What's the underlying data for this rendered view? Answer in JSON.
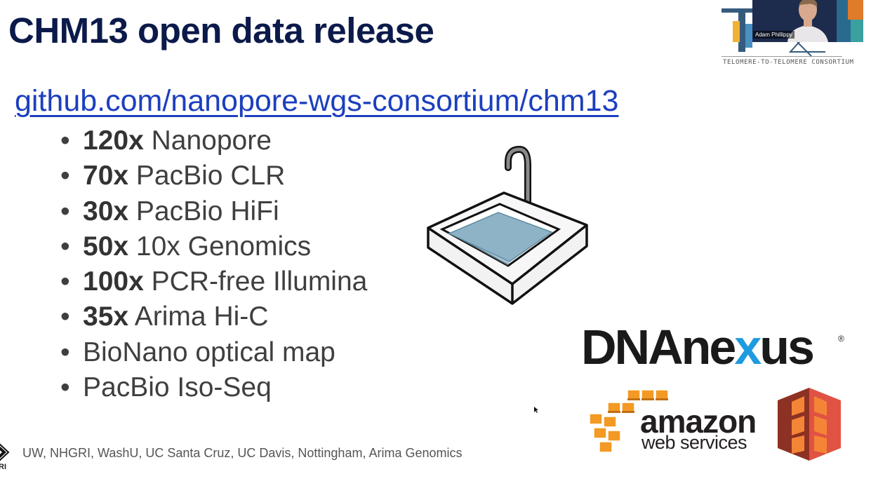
{
  "slide": {
    "title": "CHM13 open data release",
    "link": "github.com/nanopore-wgs-consortium/chm13",
    "bullets": [
      {
        "coverage": "120x",
        "text": " Nanopore"
      },
      {
        "coverage": "70x",
        "text": " PacBio CLR"
      },
      {
        "coverage": "30x",
        "text": " PacBio HiFi"
      },
      {
        "coverage": "50x",
        "text": " 10x Genomics"
      },
      {
        "coverage": "100x",
        "text": " PCR-free Illumina"
      },
      {
        "coverage": "35x",
        "text": " Arima Hi-C"
      },
      {
        "coverage": "",
        "text": "BioNano optical map"
      },
      {
        "coverage": "",
        "text": "PacBio Iso-Seq"
      }
    ],
    "bullet_symbol": "•",
    "footer": "UW, NHGRI, WashU, UC Santa Cruz, UC Davis, Nottingham, Arima Genomics",
    "side_logo_text": "RI"
  },
  "logos": {
    "t2t_caption": "TELOMERE-TO-TELOMERE CONSORTIUM",
    "dnanexus": {
      "part1": "DNAne",
      "x": "x",
      "part2": "us",
      "reg": "®"
    },
    "aws": {
      "amazon": "amazon",
      "webservices": "web services"
    },
    "icons": [
      "sink-icon",
      "aws-cubes-icon",
      "s3-bucket-icon",
      "t2t-logo"
    ]
  },
  "video": {
    "participant_name": "Adam Phillippy"
  },
  "colors": {
    "title": "#0b1a4a",
    "link": "#1c3fbf",
    "bullet_text": "#3f3f3f",
    "dnanexus_accent": "#1e9be0",
    "aws_orange": "#f29a23",
    "s3_red": "#d2503a"
  }
}
